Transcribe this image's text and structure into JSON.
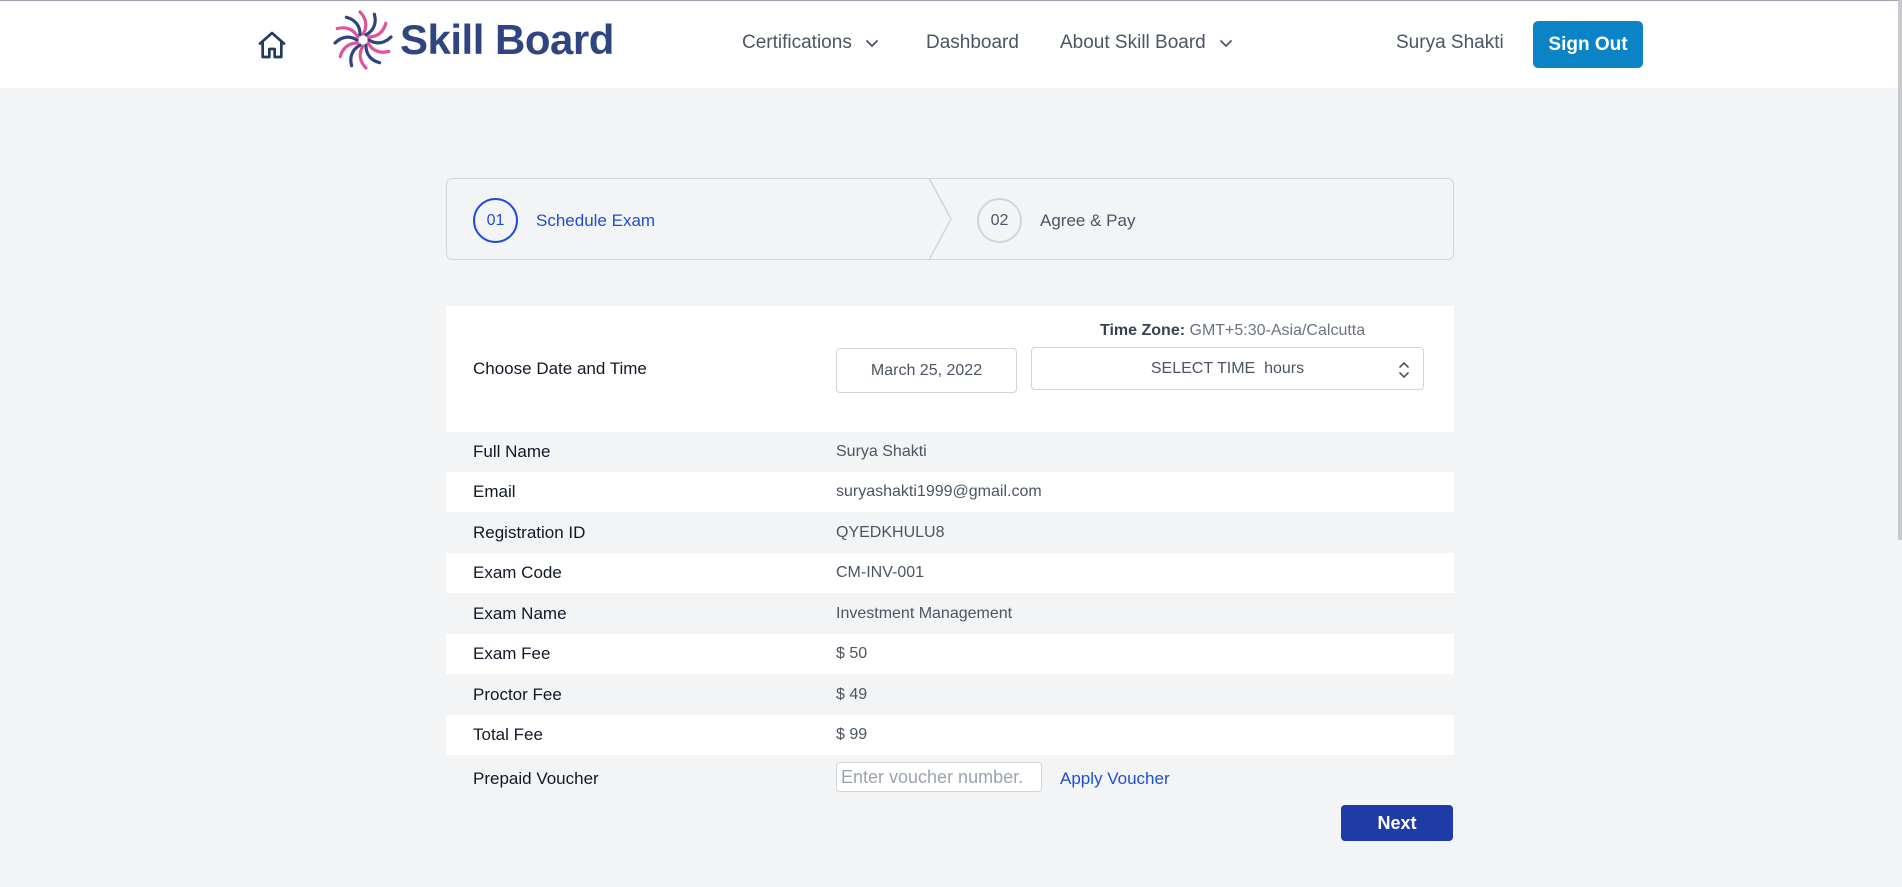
{
  "header": {
    "brand": "Skill Board",
    "nav": [
      {
        "label": "Certifications",
        "has_dropdown": true
      },
      {
        "label": "Dashboard",
        "has_dropdown": false
      },
      {
        "label": "About Skill Board",
        "has_dropdown": true
      }
    ],
    "user_name": "Surya Shakti",
    "sign_out_label": "Sign Out",
    "icons": {
      "home": "home-icon",
      "dropdown": "chevron-down-icon"
    },
    "colors": {
      "brand": "#2e4582",
      "sign_out_bg": "#0a84c6"
    }
  },
  "stepper": {
    "steps": [
      {
        "number": "01",
        "label": "Schedule Exam",
        "active": true
      },
      {
        "number": "02",
        "label": "Agree & Pay",
        "active": false
      }
    ],
    "active_color": "#1d4ed8"
  },
  "schedule": {
    "date_time_label": "Choose Date and Time",
    "timezone_label": "Time Zone:",
    "timezone_value": "GMT+5:30-Asia/Calcutta",
    "date_value": "March 25, 2022",
    "time_select_value": "SELECT TIME  hours"
  },
  "details": [
    {
      "key": "Full Name",
      "value": "Surya Shakti"
    },
    {
      "key": "Email",
      "value": "suryashakti1999@gmail.com"
    },
    {
      "key": "Registration ID",
      "value": "QYEDKHULU8"
    },
    {
      "key": "Exam Code",
      "value": "CM-INV-001"
    },
    {
      "key": "Exam Name",
      "value": "Investment Management"
    },
    {
      "key": "Exam Fee",
      "value": "$ 50"
    },
    {
      "key": "Proctor Fee",
      "value": "$ 49"
    },
    {
      "key": "Total Fee",
      "value": "$ 99"
    }
  ],
  "voucher": {
    "label": "Prepaid Voucher",
    "placeholder": "Enter voucher number.",
    "value": "",
    "apply_label": "Apply Voucher"
  },
  "next_label": "Next",
  "next_color": "#1e3ba8"
}
